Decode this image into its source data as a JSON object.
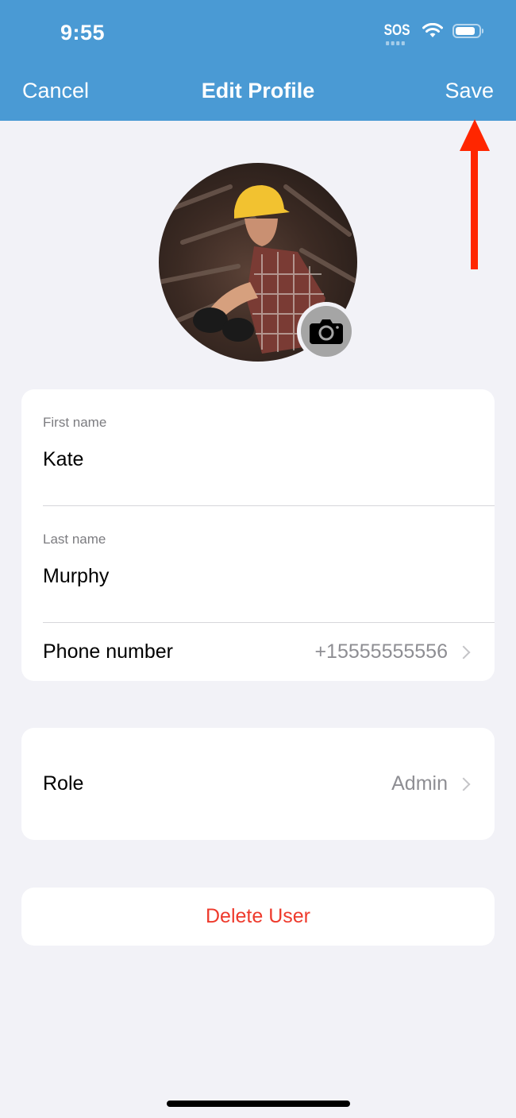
{
  "status_bar": {
    "time": "9:55",
    "sos_label": "SOS",
    "icons": [
      "sos-icon",
      "wifi-icon",
      "battery-icon"
    ]
  },
  "nav": {
    "cancel_label": "Cancel",
    "title": "Edit Profile",
    "save_label": "Save"
  },
  "annotation": {
    "arrow_color": "#ff2600",
    "points_to": "Save"
  },
  "profile": {
    "avatar_alt": "Profile photo of a worker wearing a yellow hard hat",
    "camera_icon": "camera-icon"
  },
  "form": {
    "first_name": {
      "label": "First name",
      "value": "Kate"
    },
    "last_name": {
      "label": "Last name",
      "value": "Murphy"
    },
    "phone": {
      "label": "Phone number",
      "value": "+15555555556"
    },
    "role": {
      "label": "Role",
      "value": "Admin"
    }
  },
  "actions": {
    "delete_label": "Delete User",
    "delete_color": "#ee3a2c"
  },
  "colors": {
    "header_bg": "#4a9ad4",
    "page_bg": "#f2f2f7"
  }
}
